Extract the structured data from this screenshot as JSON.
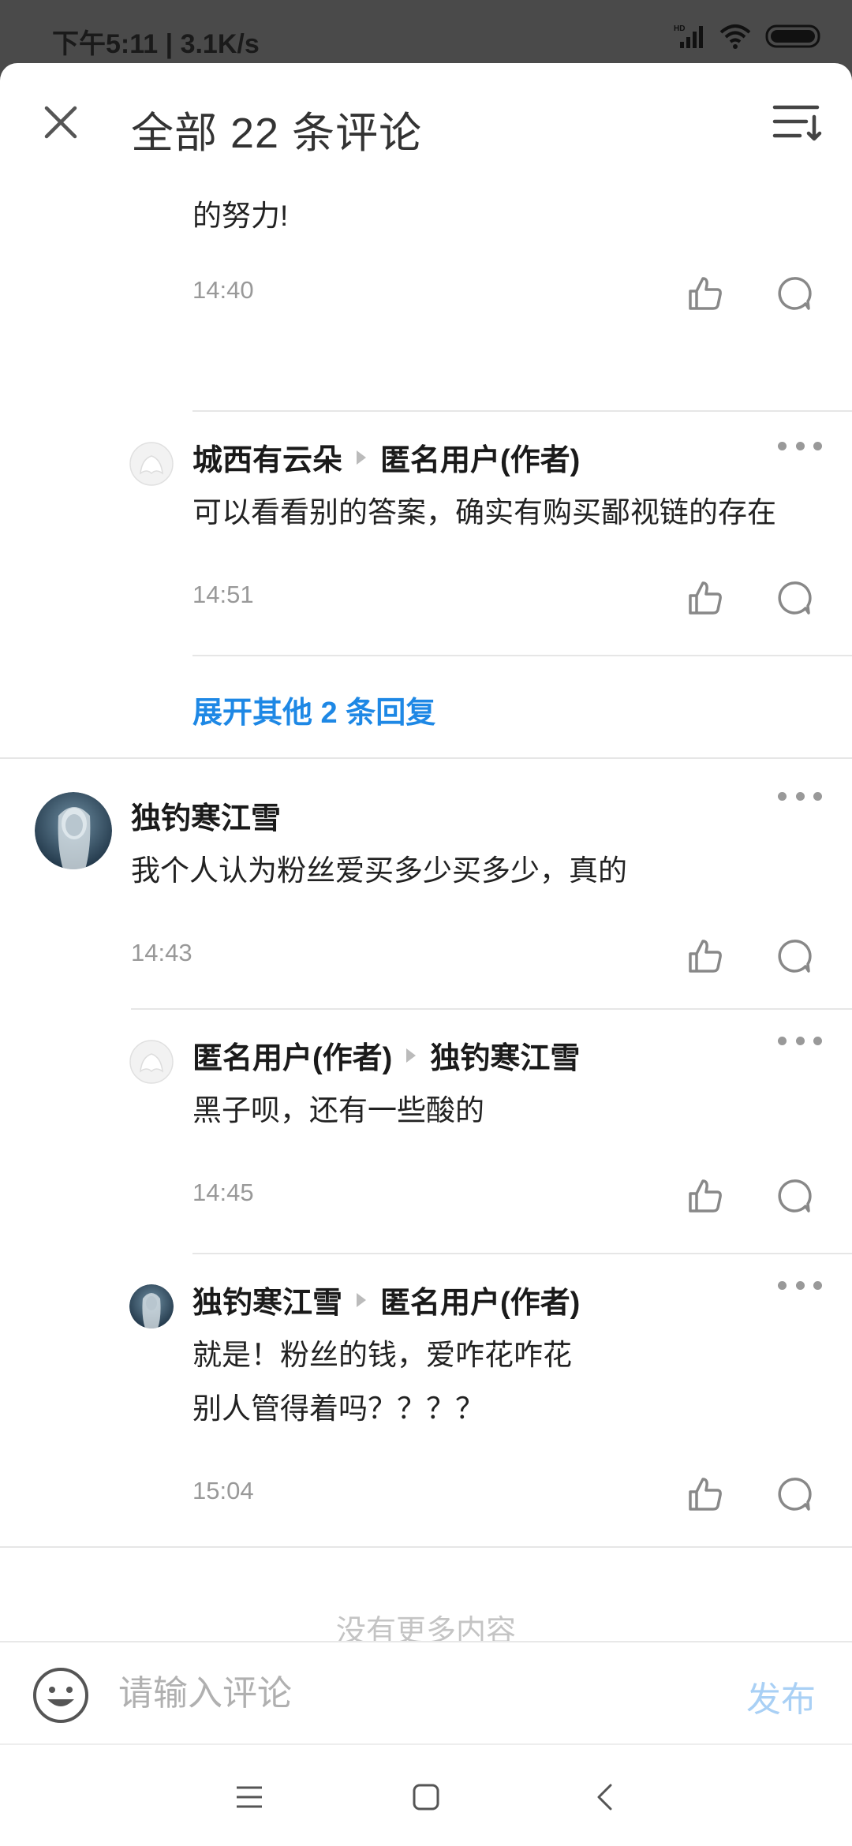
{
  "status_bar": {
    "time": "下午5:11 | 3.1K/s"
  },
  "header": {
    "title": "全部 22 条评论"
  },
  "comments": {
    "c1": {
      "text": "的努力!",
      "time": "14:40"
    },
    "c2": {
      "author": "城西有云朵",
      "reply_to": "匿名用户(作者)",
      "text": "可以看看别的答案，确实有购买鄙视链的存在",
      "time": "14:51"
    },
    "expand_label": "展开其他 2 条回复",
    "c3": {
      "author": "独钓寒江雪",
      "text": "我个人认为粉丝爱买多少买多少，真的",
      "time": "14:43"
    },
    "c4": {
      "author": "匿名用户(作者)",
      "reply_to": "独钓寒江雪",
      "text": "黑子呗，还有一些酸的",
      "time": "14:45"
    },
    "c5": {
      "author": "独钓寒江雪",
      "reply_to": "匿名用户(作者)",
      "text_line1": "就是！粉丝的钱，爱咋花咋花",
      "text_line2": "别人管得着吗？？？？",
      "time": "15:04"
    }
  },
  "footer": {
    "no_more": "没有更多内容"
  },
  "input_bar": {
    "placeholder": "请输入评论",
    "publish_label": "发布"
  },
  "colors": {
    "accent": "#1e88e5",
    "publish_disabled": "#a9d0f5"
  }
}
